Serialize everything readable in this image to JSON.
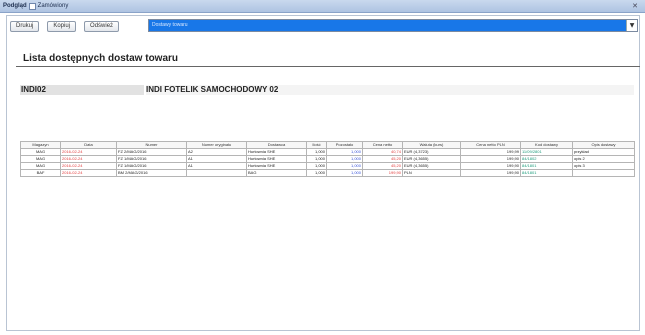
{
  "window": {
    "title": "Podgląd",
    "checkbox_label": "Zamówiony",
    "close_glyph": "✕"
  },
  "toolbar": {
    "buttons": [
      "Drukuj",
      "Kopiuj",
      "Odśwież"
    ],
    "select_value": "Dostawy towaru",
    "select_arrow": "▼"
  },
  "report": {
    "title": "Lista dostępnych dostaw towaru",
    "product_code": "INDI02",
    "product_name": "INDI FOTELIK SAMOCHODOWY 02"
  },
  "table": {
    "headers": [
      "Magazyn",
      "Data",
      "Numer",
      "Numer oryginału",
      "Dostawca",
      "Ilość",
      "Pozostało",
      "Cena netto",
      "Waluta (kurs)",
      "Cena netto PLN",
      "Kod dostawy",
      "Opis dostawy"
    ],
    "rows": [
      [
        "MAG",
        "2016-02-24",
        "FZ 2/MAG/2016",
        "A2",
        "Hurtownia SHE",
        "1,000",
        "1,000",
        "40,74",
        "EUR (4,3723)",
        "199,99",
        "11/09/2801",
        "przykład"
      ],
      [
        "MAG",
        "2016-02-24",
        "FZ 1/MAG/2016",
        "A1",
        "Hurtownia SHE",
        "1,000",
        "1,000",
        "45,20",
        "EUR (4,3655)",
        "199,90",
        "84/1802",
        "opis 2"
      ],
      [
        "MAG",
        "2016-02-24",
        "FZ 1/MAG/2016",
        "A1",
        "Hurtownia SHE",
        "1,000",
        "1,000",
        "45,20",
        "EUR (4,3655)",
        "199,90",
        "84/1801",
        "opis 3"
      ],
      [
        "BAF",
        "2016-02-24",
        "BM 2/MAG/2016",
        "",
        "BAG",
        "1,000",
        "1,000",
        "199,90",
        "PLN",
        "199,90",
        "84/1801",
        ""
      ]
    ]
  },
  "colors": {
    "date": "#e23b3b",
    "remaining": "#3a55d9",
    "price": "#e23b3b",
    "code": "#1a9a7a"
  }
}
